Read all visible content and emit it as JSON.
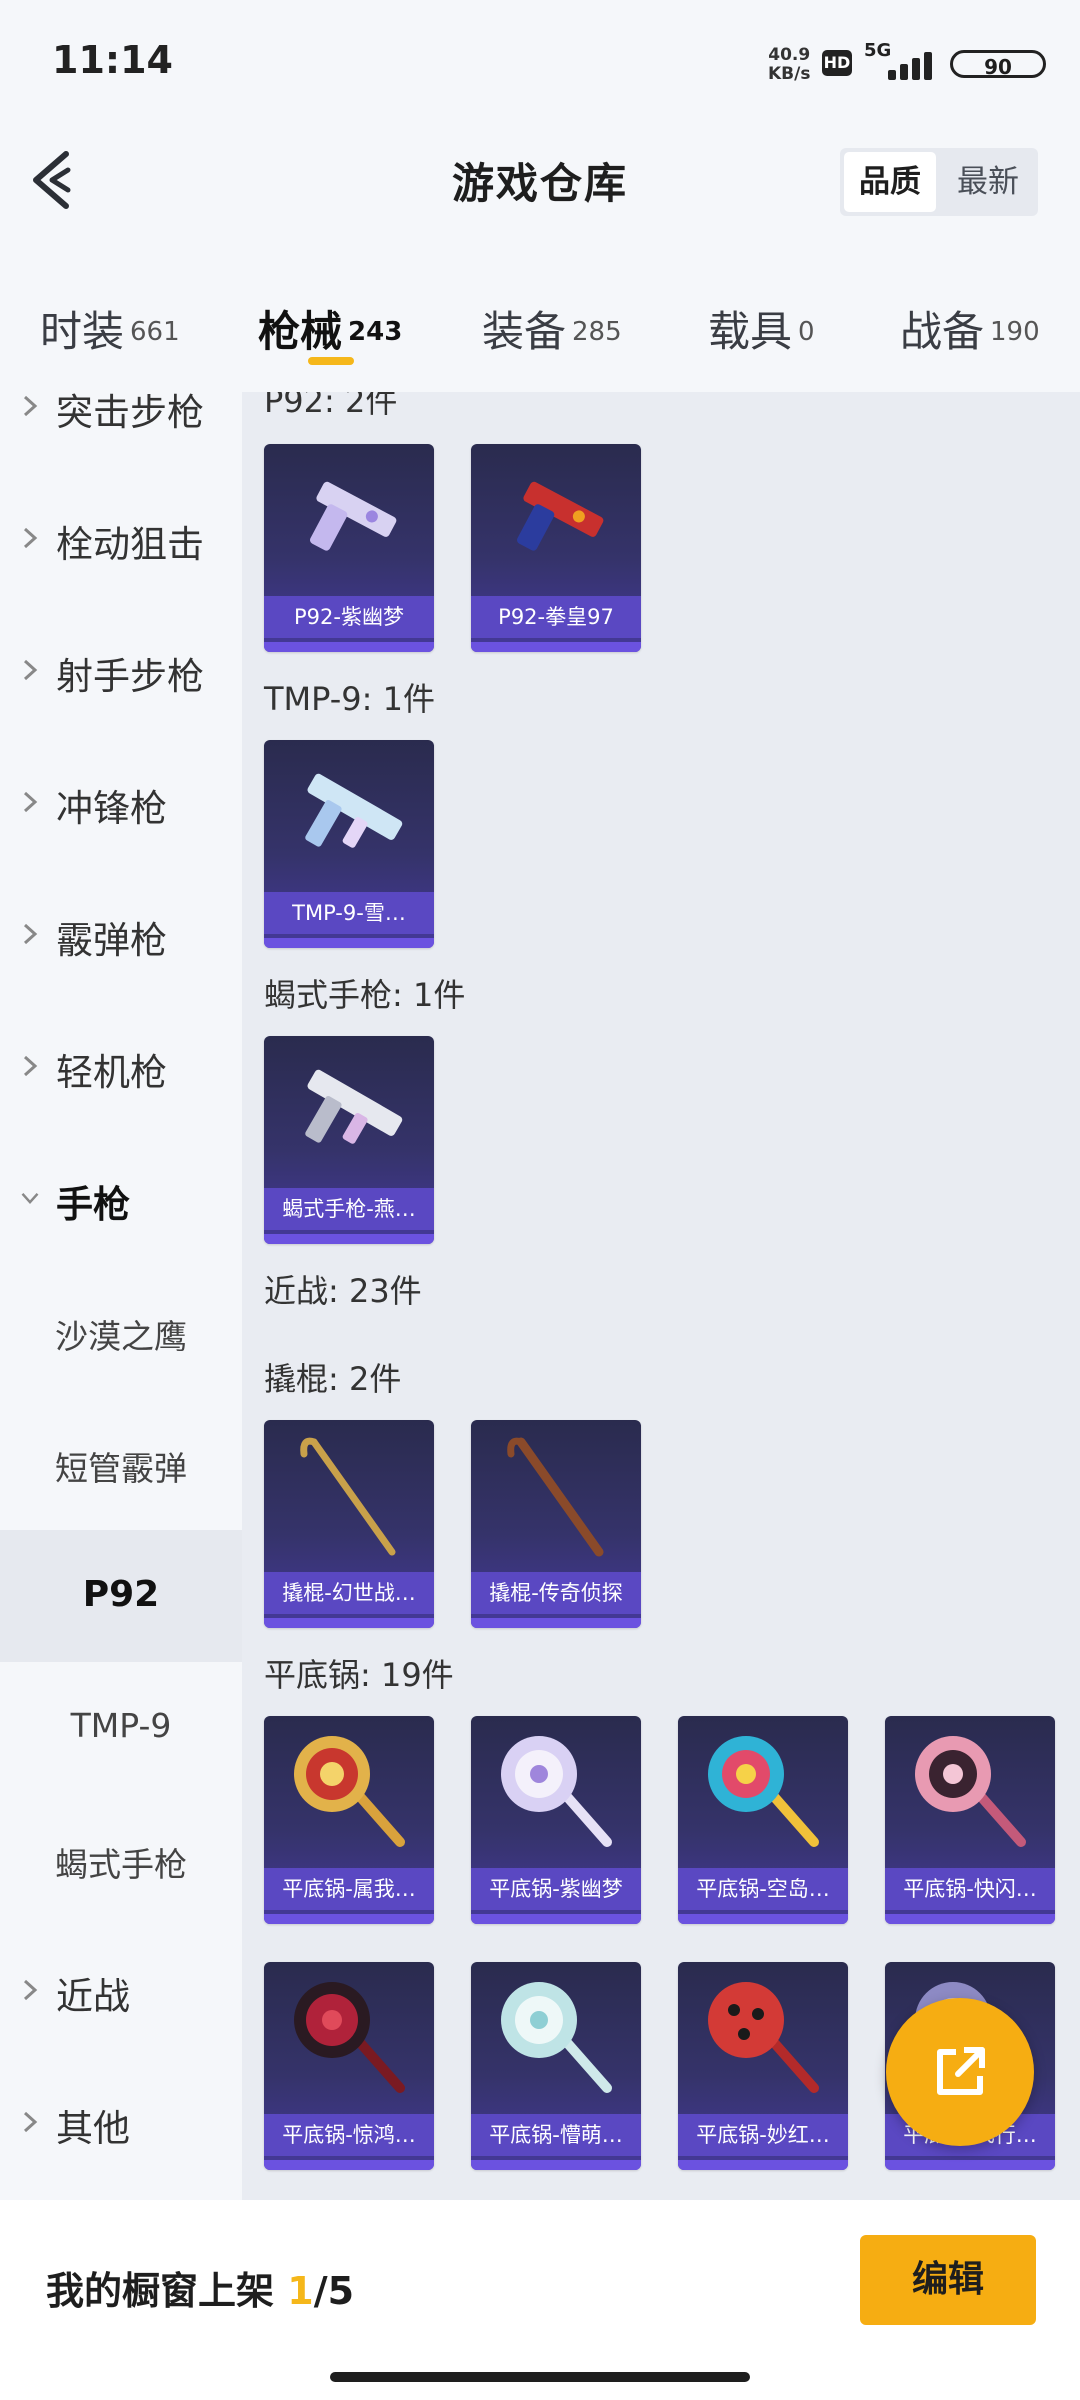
{
  "status": {
    "time": "11:14",
    "net_speed": "40.9",
    "net_unit": "KB/s",
    "hd": "HD",
    "signal": "5G",
    "battery": "90"
  },
  "header": {
    "title": "游戏仓库",
    "sort_quality": "品质",
    "sort_newest": "最新"
  },
  "tabs": [
    {
      "label": "时装",
      "count": "661"
    },
    {
      "label": "枪械",
      "count": "243"
    },
    {
      "label": "装备",
      "count": "285"
    },
    {
      "label": "载具",
      "count": "0"
    },
    {
      "label": "战备",
      "count": "190"
    }
  ],
  "sidebar": {
    "items": [
      {
        "label": "突击步枪"
      },
      {
        "label": "栓动狙击"
      },
      {
        "label": "射手步枪"
      },
      {
        "label": "冲锋枪"
      },
      {
        "label": "霰弹枪"
      },
      {
        "label": "轻机枪"
      },
      {
        "label": "手枪"
      },
      {
        "label": "近战"
      },
      {
        "label": "其他"
      }
    ],
    "subitems": [
      {
        "label": "沙漠之鹰"
      },
      {
        "label": "短管霰弹"
      },
      {
        "label": "P92"
      },
      {
        "label": "TMP-9"
      },
      {
        "label": "蝎式手枪"
      }
    ]
  },
  "main": {
    "sections": [
      {
        "title": "P92: 2件"
      },
      {
        "title": "TMP-9: 1件"
      },
      {
        "title": "蝎式手枪: 1件"
      },
      {
        "title": "近战: 23件"
      },
      {
        "title": "撬棍: 2件"
      },
      {
        "title": "平底锅: 19件"
      }
    ],
    "items": [
      {
        "name": "P92-紫幽梦",
        "icon": "pistol-icon"
      },
      {
        "name": "P92-拳皇97",
        "icon": "pistol-icon"
      },
      {
        "name": "TMP-9-雪…",
        "icon": "smg-icon"
      },
      {
        "name": "蝎式手枪-燕…",
        "icon": "smg-icon"
      },
      {
        "name": "撬棍-幻世战…",
        "icon": "crowbar-icon"
      },
      {
        "name": "撬棍-传奇侦探",
        "icon": "crowbar-icon"
      },
      {
        "name": "平底锅-属我…",
        "icon": "pan-icon"
      },
      {
        "name": "平底锅-紫幽梦",
        "icon": "pan-icon"
      },
      {
        "name": "平底锅-空岛…",
        "icon": "pan-icon"
      },
      {
        "name": "平底锅-快闪…",
        "icon": "pan-icon"
      },
      {
        "name": "平底锅-惊鸿…",
        "icon": "pan-icon"
      },
      {
        "name": "平底锅-懵萌…",
        "icon": "pan-icon"
      },
      {
        "name": "平底锅-妙红…",
        "icon": "pan-icon"
      },
      {
        "name": "平底锅-飞行…",
        "icon": "pan-icon"
      }
    ]
  },
  "bottom": {
    "label": "我的橱窗上架 ",
    "current": "1",
    "total": "/5",
    "edit_button": "编辑"
  },
  "colors": {
    "accent": "#f6ad12",
    "card_bg": "#35336a",
    "card_caption": "#5a48c2"
  }
}
